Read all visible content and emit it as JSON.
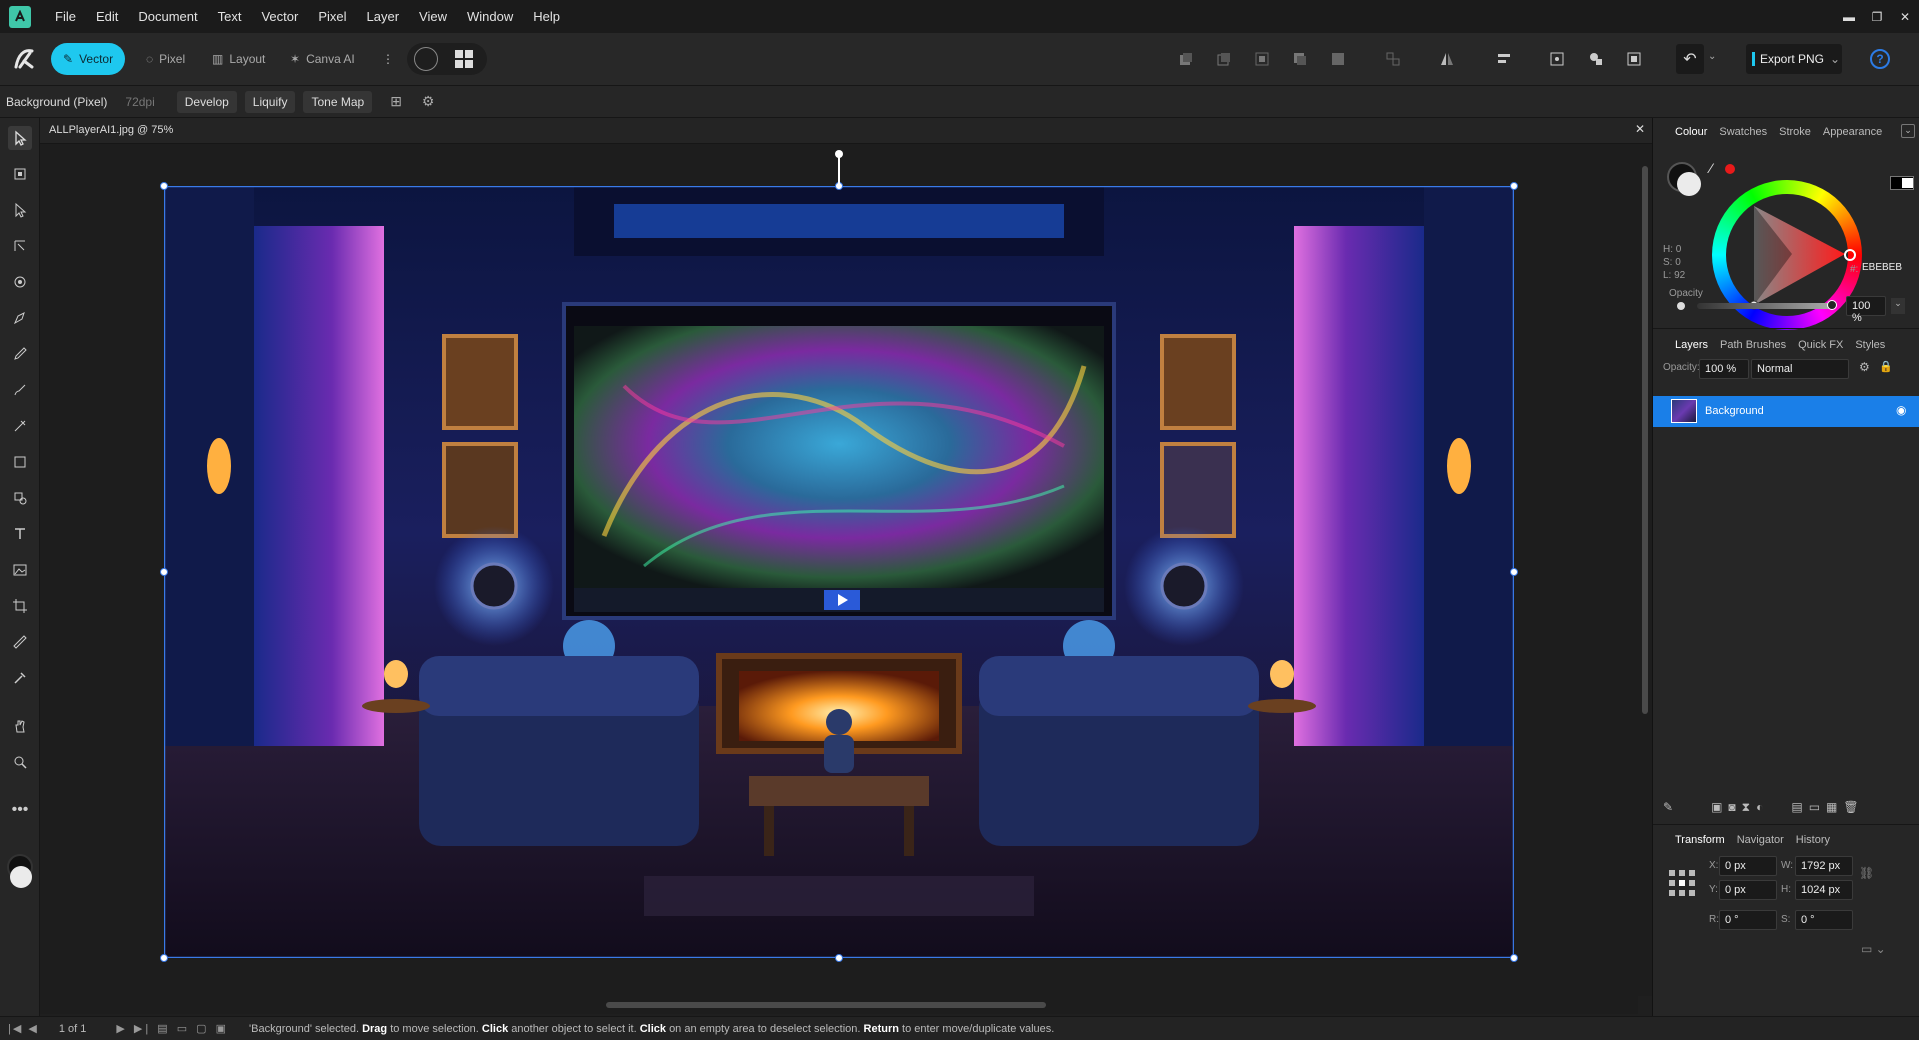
{
  "menubar": {
    "items": [
      "File",
      "Edit",
      "Document",
      "Text",
      "Vector",
      "Pixel",
      "Layer",
      "View",
      "Window",
      "Help"
    ]
  },
  "toolbar": {
    "personas": [
      "Vector",
      "Pixel",
      "Layout",
      "Canva AI"
    ],
    "active_persona": "Vector",
    "export_label": "Export PNG",
    "accent": "#1ec8ef"
  },
  "context": {
    "layer_label": "Background (Pixel)",
    "dpi": "72dpi",
    "buttons": [
      "Develop",
      "Liquify",
      "Tone Map"
    ]
  },
  "document": {
    "tab_title": "ALLPlayerAI1.jpg @ 75%"
  },
  "colour_panel": {
    "tabs": [
      "Colour",
      "Swatches",
      "Stroke",
      "Appearance"
    ],
    "active": "Colour",
    "h": "H: 0",
    "s": "S: 0",
    "l": "L: 92",
    "hex": "EBEBEB",
    "hex_prefix": "#:",
    "opacity_label": "Opacity",
    "opacity_value": "100 %"
  },
  "layers_panel": {
    "tabs": [
      "Layers",
      "Path Brushes",
      "Quick FX",
      "Styles"
    ],
    "active": "Layers",
    "opacity_label": "Opacity:",
    "opacity_value": "100 %",
    "blend_mode": "Normal",
    "layers": [
      {
        "name": "Background",
        "selected": true
      }
    ],
    "highlight": "#1a7fe8"
  },
  "transform_panel": {
    "tabs": [
      "Transform",
      "Navigator",
      "History"
    ],
    "active": "Transform",
    "x_label": "X:",
    "x": "0 px",
    "y_label": "Y:",
    "y": "0 px",
    "w_label": "W:",
    "w": "1792 px",
    "h_label": "H:",
    "h": "1024 px",
    "r_label": "R:",
    "r": "0 °",
    "s_label": "S:",
    "s": "0 °"
  },
  "status": {
    "page": "1 of 1",
    "msg_a": "'Background' selected.",
    "msg_b": "Drag",
    "msg_c": "to move selection.",
    "msg_d": "Click",
    "msg_e": "another object to select it.",
    "msg_f": "Click",
    "msg_g": "on an empty area to deselect selection.",
    "msg_h": "Return",
    "msg_i": "to enter move/duplicate values."
  },
  "icons": [
    "app-logo-icon",
    "move-tool-icon",
    "artboard-icon",
    "node-icon",
    "contour-icon",
    "pen-icon",
    "pencil-icon",
    "brush-icon",
    "fill-icon",
    "rectangle-icon",
    "shape-icon",
    "text-icon",
    "image-icon",
    "crop-icon",
    "eyedropper-icon",
    "hand-icon",
    "zoom-icon",
    "more-icon"
  ]
}
